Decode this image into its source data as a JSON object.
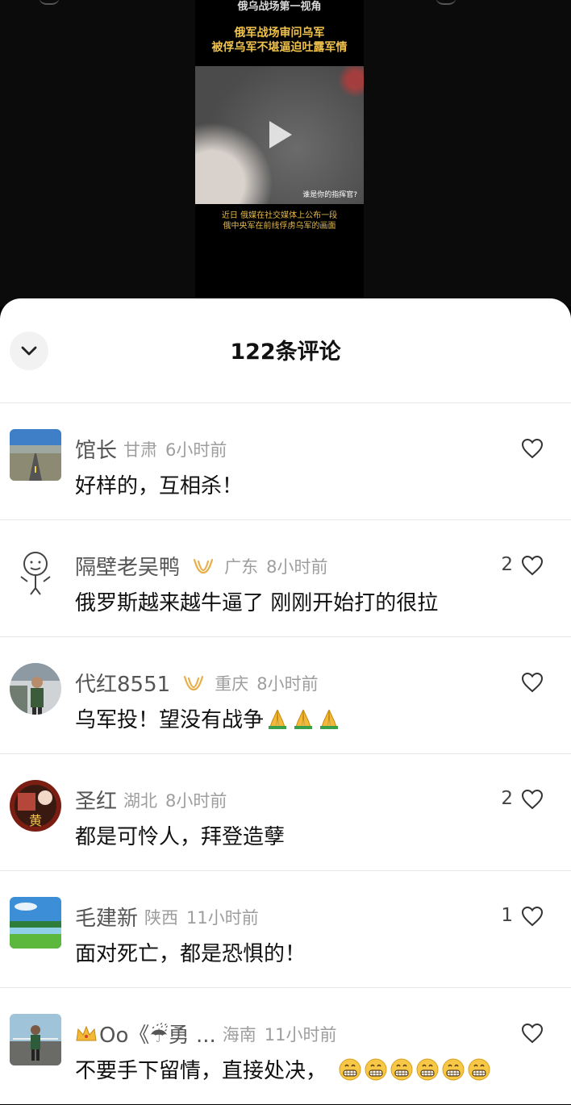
{
  "video": {
    "top_caption": "俄乌战场第一视角",
    "headline_line1": "俄军战场审问乌军",
    "headline_line2": "被俘乌军不堪逼迫吐露军情",
    "frame_subtitle": "谁是你的指挥官?",
    "subtitle_line1": "近日 俄媒在社交媒体上公布一段",
    "subtitle_line2": "俄中央军在前线俘虏乌军的画面"
  },
  "sheet": {
    "title": "122条评论"
  },
  "comments": [
    {
      "name": "馆长",
      "location": "甘肃",
      "time": "6小时前",
      "text": "好样的，互相杀！",
      "likes": ""
    },
    {
      "name": "隔壁老吴鸭",
      "location": "广东",
      "time": "8小时前",
      "text": "俄罗斯越来越牛逼了 刚刚开始打的很拉",
      "likes": "2"
    },
    {
      "name": "代红8551",
      "location": "重庆",
      "time": "8小时前",
      "text": "乌军投！望没有战争",
      "likes": ""
    },
    {
      "name": "圣红",
      "location": "湖北",
      "time": "8小时前",
      "text": "都是可怜人，拜登造孽",
      "likes": "2"
    },
    {
      "name": "毛建新",
      "location": "陕西",
      "time": "11小时前",
      "text": "面对死亡，都是恐惧的！",
      "likes": "1"
    },
    {
      "name": "Oo《☔勇 ...",
      "location": "海南",
      "time": "11小时前",
      "text": "不要手下留情，直接处决，",
      "likes": ""
    }
  ],
  "colors": {
    "crown": "#e8b04a",
    "accent_caption": "#f0c24a",
    "secondary_text": "#9e9e9e"
  },
  "icons": {
    "collapse": "chevron-down-icon",
    "like": "heart-outline-icon",
    "praying": "praying-hands-emoji",
    "grin": "grinning-face-emoji",
    "crown": "crown-badge-icon"
  }
}
